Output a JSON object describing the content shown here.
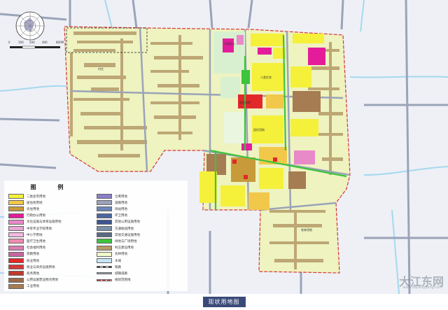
{
  "caption": "现状用地图",
  "legend": {
    "title": "图 例",
    "items_left": [
      {
        "label": "二类住宅用地",
        "color": "#f5f03a"
      },
      {
        "label": "居住商用地",
        "color": "#f1c84a"
      },
      {
        "label": "农住用地",
        "color": "#c79a3a"
      },
      {
        "label": "行政办公用地",
        "color": "#e41c9a"
      },
      {
        "label": "文化设施与体育设施用地",
        "color": "#e889c8"
      },
      {
        "label": "中等专业学校用地",
        "color": "#e7a6d4"
      },
      {
        "label": "中小学用地",
        "color": "#f2b8e0"
      },
      {
        "label": "医疗卫生用地",
        "color": "#f08ab0"
      },
      {
        "label": "社会福利用地",
        "color": "#d67fb2"
      },
      {
        "label": "宗教用地",
        "color": "#c865a0"
      },
      {
        "label": "商业用地",
        "color": "#e2282a"
      },
      {
        "label": "商业与商务设施用地",
        "color": "#d43a3a"
      },
      {
        "label": "商务用地",
        "color": "#c0392b"
      },
      {
        "label": "公用设施营业网点用地",
        "color": "#9b6a4a"
      },
      {
        "label": "工业用地",
        "color": "#a67c52"
      }
    ],
    "items_right": [
      {
        "label": "仓库用地",
        "color": "#8a7fc8"
      },
      {
        "label": "道路用地",
        "color": "#9aa3b8"
      },
      {
        "label": "场站用地",
        "color": "#6d86b8"
      },
      {
        "label": "环卫用地",
        "color": "#4a66a0"
      },
      {
        "label": "其他公用设施用地",
        "color": "#3d5690"
      },
      {
        "label": "交通枢纽用地",
        "color": "#7a8fa8"
      },
      {
        "label": "其他交通设施用地",
        "color": "#5a6a82"
      },
      {
        "label": "绿地与广场用地",
        "color": "#3cc43c"
      },
      {
        "label": "村庄建设用地",
        "color": "#b59a68"
      },
      {
        "label": "农林用地",
        "color": "#f1f8c8"
      },
      {
        "label": "水域",
        "color": "#c6e6f6"
      },
      {
        "label": "铁路",
        "color": "#ffffff"
      },
      {
        "label": "城镇道路",
        "color": "#ffffff"
      },
      {
        "label": "规划范围线",
        "color": "#ffffff"
      }
    ]
  },
  "scale": {
    "labels": [
      "0",
      "100",
      "200",
      "400",
      "800M"
    ]
  },
  "watermark": {
    "main": "大江东网",
    "sub": "www.dajiangdong.com"
  },
  "map_labels": [
    "二类住宅",
    "居住用地",
    "行政办公",
    "商业用地",
    "村庄",
    "农林用地"
  ],
  "colors": {
    "background": "#eef0f6",
    "farmland": "#eef3c0",
    "village": "#b59a68",
    "road": "#9aa3b8",
    "water": "#a5d8ee",
    "boundary": "#d83434"
  }
}
